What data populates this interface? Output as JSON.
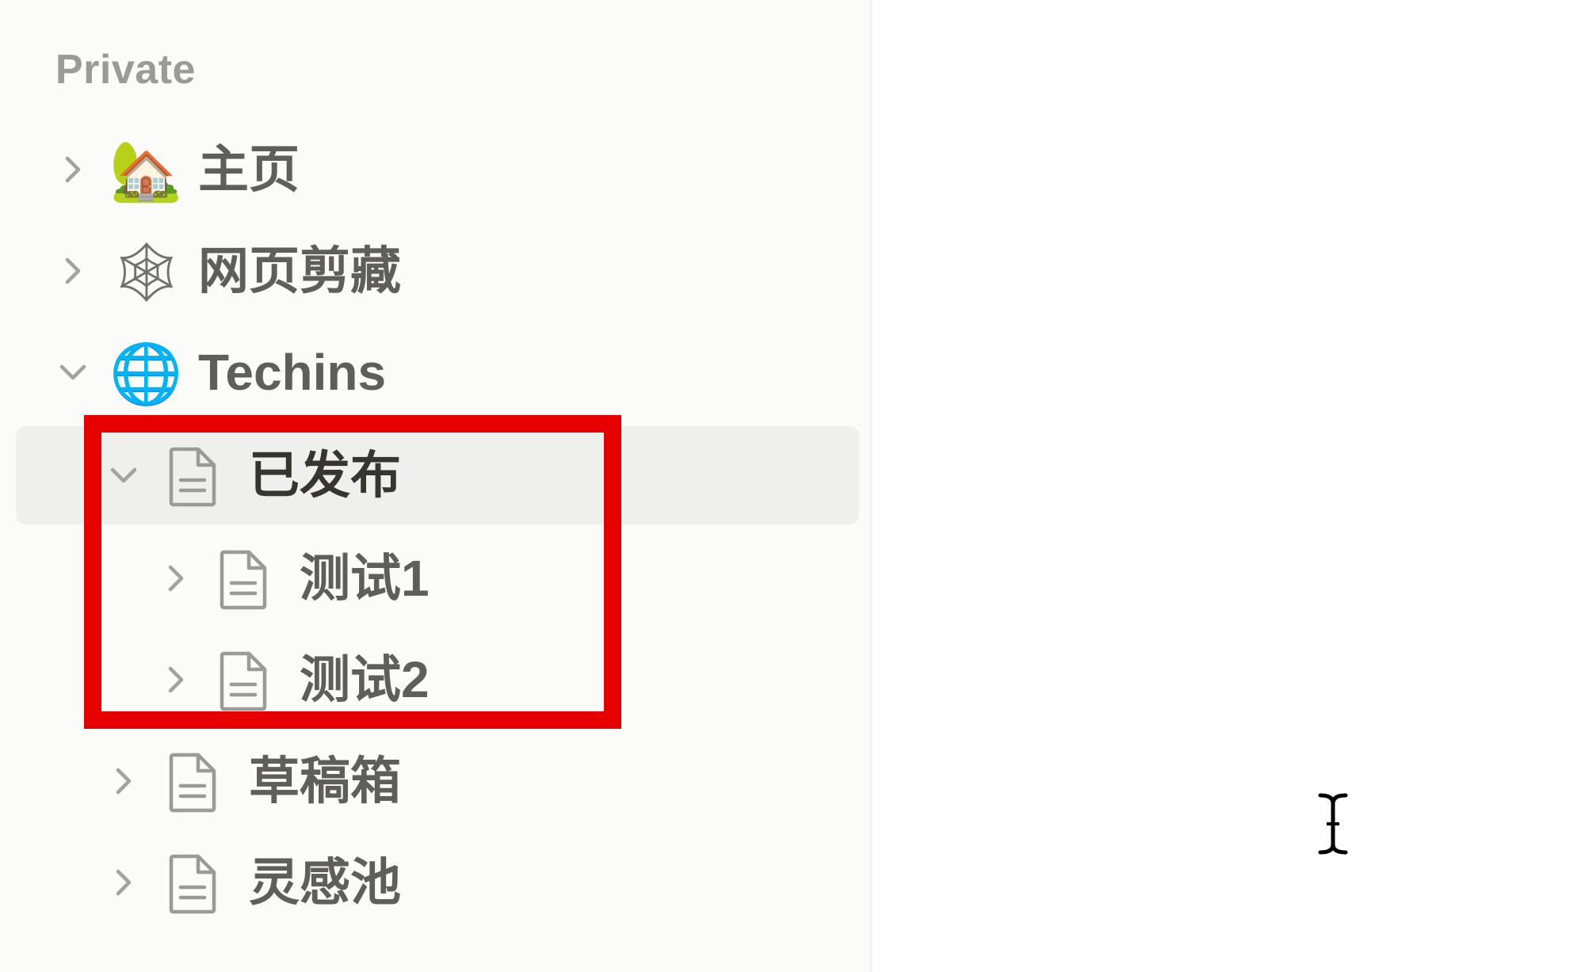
{
  "sidebar": {
    "section_label": "Private",
    "items": [
      {
        "label": "主页",
        "icon": "house-with-garden-emoji",
        "emoji": "🏡",
        "expanded": false
      },
      {
        "label": "网页剪藏",
        "icon": "spider-web-emoji",
        "emoji": "🕸",
        "expanded": false
      },
      {
        "label": "Techins",
        "icon": "globe-emoji",
        "emoji": "🌐",
        "expanded": true,
        "children": [
          {
            "label": "已发布",
            "icon": "page-icon",
            "expanded": true,
            "selected": true,
            "children": [
              {
                "label": "测试1",
                "icon": "page-icon",
                "expanded": false
              },
              {
                "label": "测试2",
                "icon": "page-icon",
                "expanded": false
              }
            ]
          },
          {
            "label": "草稿箱",
            "icon": "page-icon",
            "expanded": false
          },
          {
            "label": "灵感池",
            "icon": "page-icon",
            "expanded": false
          }
        ]
      }
    ]
  },
  "colors": {
    "sidebar_bg": "#fbfbfa",
    "selected_bg": "#efefed",
    "text_muted": "#5f5e5b",
    "text_dark": "#37352f",
    "highlight": "#e60000"
  }
}
